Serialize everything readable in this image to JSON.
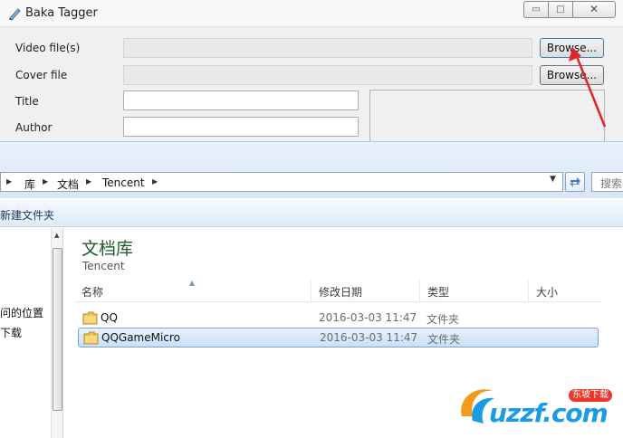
{
  "tagger": {
    "title": "Baka Tagger",
    "window_buttons": {
      "minimize": "▭",
      "maximize": "□",
      "close": "✕"
    },
    "fields": {
      "video_label": "Video file(s)",
      "cover_label": "Cover file",
      "title_label": "Title",
      "author_label": "Author",
      "video_value": "",
      "cover_value": "",
      "title_value": "",
      "author_value": ""
    },
    "browse_label": "Browse..."
  },
  "explorer": {
    "breadcrumb": [
      "库",
      "文档",
      "Tencent"
    ],
    "search_placeholder": "搜索",
    "toolbar": {
      "new_folder": "新建文件夹"
    },
    "nav_items": [
      "问的位置",
      "下载"
    ],
    "library": {
      "title": "文档库",
      "subtitle": "Tencent"
    },
    "columns": {
      "name": "名称",
      "date": "修改日期",
      "type": "类型",
      "size": "大小"
    },
    "rows": [
      {
        "name": "QQ",
        "date": "2016-03-03 11:47",
        "type": "文件夹",
        "selected": false
      },
      {
        "name": "QQGameMicro",
        "date": "2016-03-03 11:47",
        "type": "文件夹",
        "selected": true
      }
    ]
  },
  "watermark": {
    "badge": "东坡下载",
    "text": "uzzf.com"
  },
  "colors": {
    "annotation_arrow": "#e0262b",
    "library_title": "#1d5a2c",
    "selection": "#c9e0f7"
  }
}
